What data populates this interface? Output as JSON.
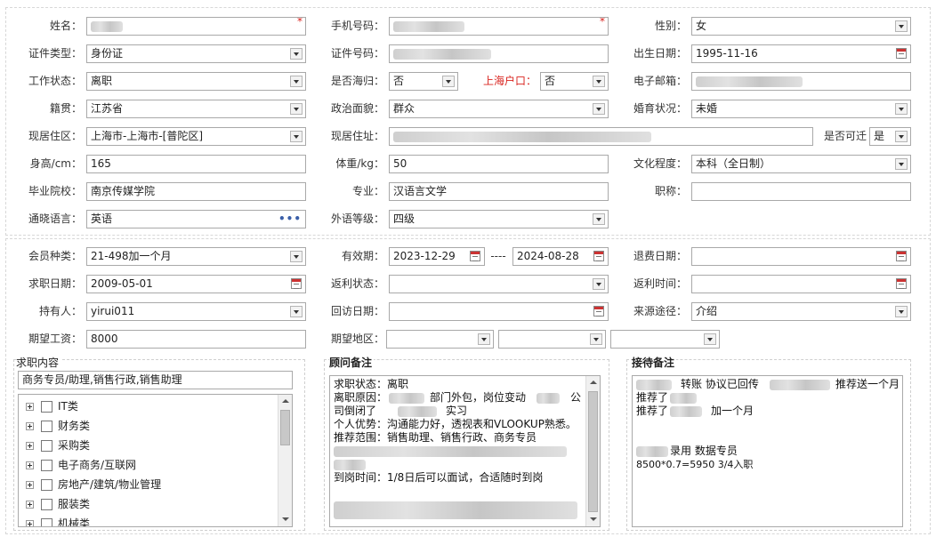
{
  "section1": {
    "name_label": "姓名：",
    "phone_label": "手机号码：",
    "gender_label": "性别：",
    "gender_value": "女",
    "idtype_label": "证件类型：",
    "idtype_value": "身份证",
    "idno_label": "证件号码：",
    "birth_label": "出生日期：",
    "birth_value": "1995-11-16",
    "workstatus_label": "工作状态：",
    "workstatus_value": "离职",
    "returnee_label": "是否海归：",
    "returnee_value": "否",
    "shanghai_hukou_label": "上海户口：",
    "shanghai_hukou_value": "否",
    "email_label": "电子邮箱：",
    "native_label": "籍贯：",
    "native_value": "江苏省",
    "political_label": "政治面貌：",
    "political_value": "群众",
    "marital_label": "婚育状况：",
    "marital_value": "未婚",
    "residence_area_label": "现居住区：",
    "residence_area_value": "上海市-上海市-[普陀区]",
    "residence_address_label": "现居住址：",
    "can_transport_label": "是否可迁",
    "can_transport_value": "是",
    "height_label": "身高/cm：",
    "height_value": "165",
    "weight_label": "体重/kg：",
    "weight_value": "50",
    "education_label": "文化程度：",
    "education_value": "本科（全日制）",
    "school_label": "毕业院校：",
    "school_value": "南京传媒学院",
    "major_label": "专业：",
    "major_value": "汉语言文学",
    "title_label": "职称：",
    "language_label": "通晓语言：",
    "language_value": "英语",
    "language_more": "•••",
    "foreign_level_label": "外语等级：",
    "foreign_level_value": "四级",
    "required_mark": "*"
  },
  "section2": {
    "member_type_label": "会员种类：",
    "member_type_value": "21-498加一个月",
    "valid_label": "有效期：",
    "valid_from": "2023-12-29",
    "valid_sep": "----",
    "valid_to": "2024-08-28",
    "refund_date_label": "退费日期：",
    "job_date_label": "求职日期：",
    "job_date_value": "2009-05-01",
    "rebate_status_label": "返利状态：",
    "rebate_time_label": "返利时间：",
    "holder_label": "持有人：",
    "holder_value": "yirui011",
    "revisit_label": "回访日期：",
    "source_label": "来源途径：",
    "source_value": "介绍",
    "salary_label": "期望工资：",
    "salary_value": "8000",
    "region_label": "期望地区："
  },
  "job_content": {
    "title": "求职内容",
    "selected": "商务专员/助理,销售行政,销售助理",
    "tree_items": [
      "IT类",
      "财务类",
      "采购类",
      "电子商务/互联网",
      "房地产/建筑/物业管理",
      "服装类",
      "机械类"
    ]
  },
  "consultant_notes": {
    "title": "顾问备注",
    "lines": [
      "求职状态：离职",
      "离职原因：",
      "部门外包，岗位变动",
      "公",
      "司倒闭了",
      "实习",
      "个人优势：沟通能力好，透视表和VLOOKUP熟悉。",
      "推荐范围：销售助理、销售行政、商务专员",
      "到岗时间：1/8日后可以面试，合适随时到岗"
    ]
  },
  "reception_notes": {
    "title": "接待备注",
    "line1_a": "转账 协议已回传",
    "line1_b": "推荐送一个月",
    "line2": "推荐了",
    "line3_a": "推荐了",
    "line3_b": "加一个月",
    "line4": "录用 数据专员",
    "line5": "8500*0.7=5950  3/4入职"
  },
  "colors": {
    "required": "#d9231e",
    "border": "#a9a9a9",
    "dashed": "#d7d7d7"
  }
}
